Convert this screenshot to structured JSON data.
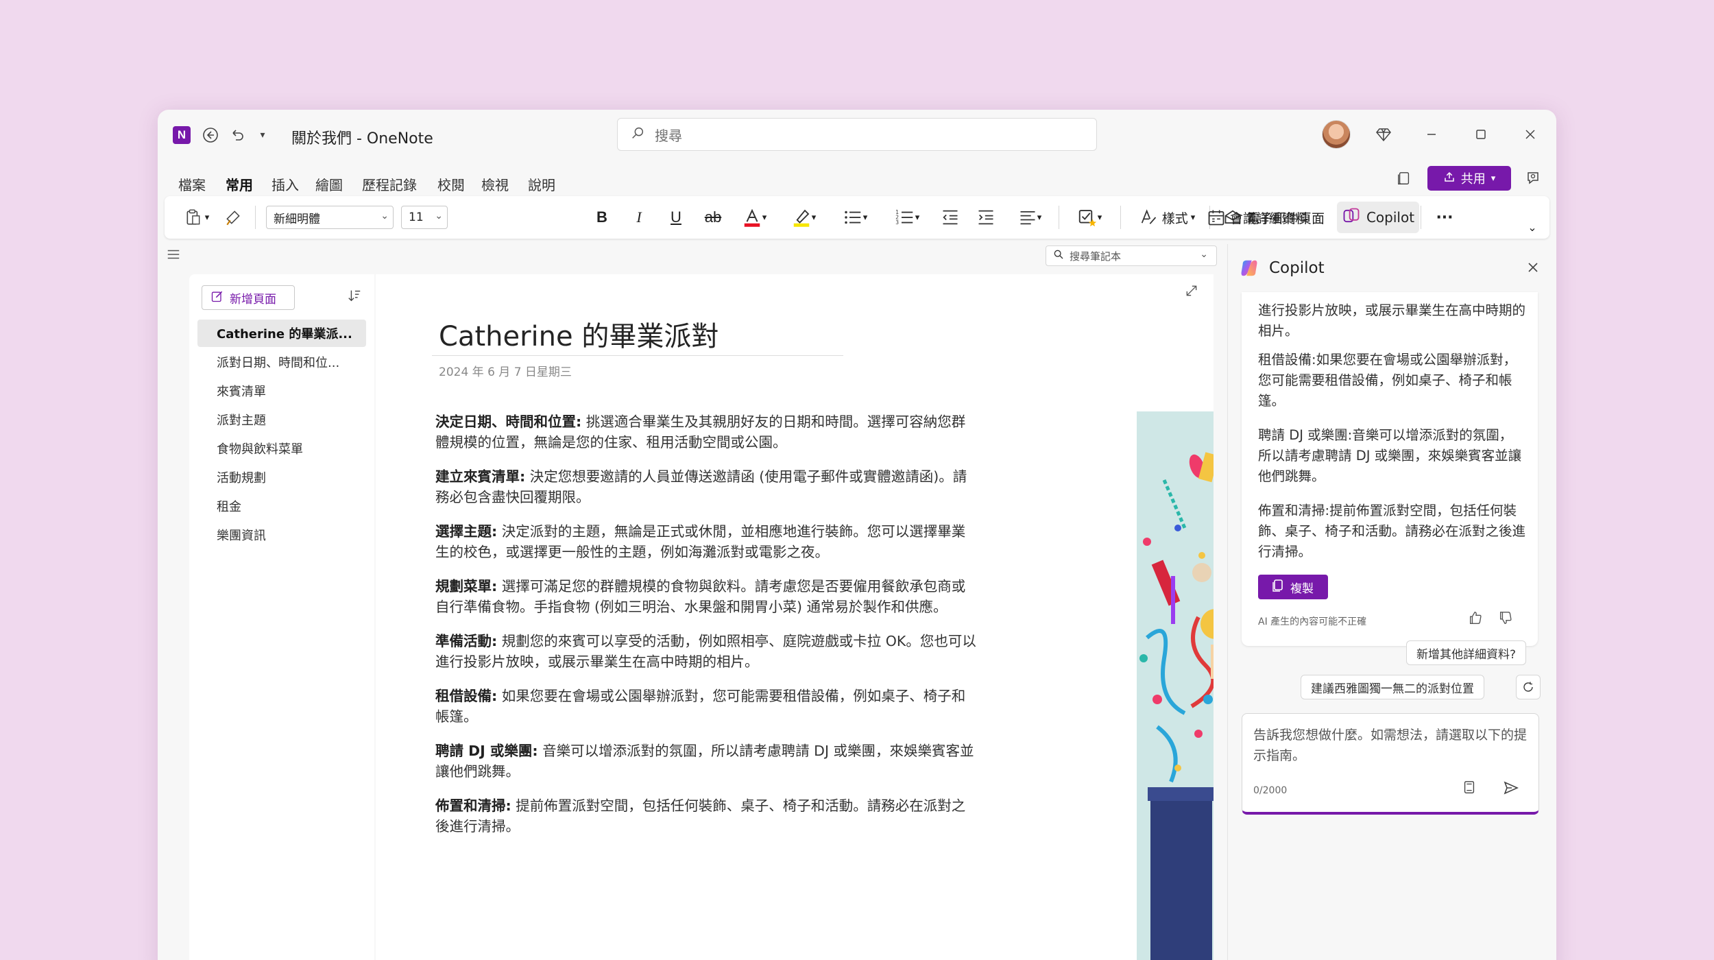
{
  "app": {
    "title": "關於我們 - OneNote",
    "logo_letter": "N",
    "search_placeholder": "搜尋"
  },
  "menu": {
    "tabs": [
      "檔案",
      "常用",
      "插入",
      "繪圖",
      "歷程記錄",
      "校閱",
      "檢視",
      "說明"
    ],
    "active": "常用",
    "share_label": "共用"
  },
  "ribbon": {
    "font_name": "新細明體",
    "font_size": "11",
    "styles_label": "樣式",
    "email_page_label": "電子郵件頁面",
    "meeting_details_label": "會議詳細資料",
    "copilot_label": "Copilot",
    "more": "···"
  },
  "notebook_search": {
    "placeholder": "搜尋筆記本"
  },
  "pages": {
    "new_page_label": "新增頁面",
    "items": [
      "Catherine 的畢業派...",
      "派對日期、時間和位...",
      "來賓清單",
      "派對主題",
      "食物與飲料菜單",
      "活動規劃",
      "租金",
      "樂團資訊"
    ]
  },
  "page": {
    "title": "Catherine 的畢業派對",
    "date": "2024 年 6 月 7 日星期三",
    "paragraphs": [
      {
        "bold": "決定日期、時間和位置:",
        "text": " 挑選適合畢業生及其親朋好友的日期和時間。選擇可容納您群體規模的位置，無論是您的住家、租用活動空間或公園。"
      },
      {
        "bold": "建立來賓清單:",
        "text": " 決定您想要邀請的人員並傳送邀請函 (使用電子郵件或實體邀請函)。請務必包含盡快回覆期限。"
      },
      {
        "bold": "選擇主題:",
        "text": " 決定派對的主題，無論是正式或休閒，並相應地進行裝飾。您可以選擇畢業生的校色，或選擇更一般性的主題，例如海灘派對或電影之夜。"
      },
      {
        "bold": "規劃菜單:",
        "text": " 選擇可滿足您的群體規模的食物與飲料。請考慮您是否要僱用餐飲承包商或自行準備食物。手指食物 (例如三明治、水果盤和開胃小菜) 通常易於製作和供應。"
      },
      {
        "bold": "準備活動:",
        "text": " 規劃您的來賓可以享受的活動，例如照相亭、庭院遊戲或卡拉 OK。您也可以進行投影片放映，或展示畢業生在高中時期的相片。"
      },
      {
        "bold": "租借設備:",
        "text": " 如果您要在會場或公園舉辦派對，您可能需要租借設備，例如桌子、椅子和帳篷。"
      },
      {
        "bold": "聘請 DJ 或樂團:",
        "text": " 音樂可以增添派對的氛圍，所以請考慮聘請 DJ 或樂團，來娛樂賓客並讓他們跳舞。"
      },
      {
        "bold": "佈置和清掃:",
        "text": " 提前佈置派對空間，包括任何裝飾、桌子、椅子和活動。請務必在派對之後進行清掃。"
      }
    ]
  },
  "copilot": {
    "title": "Copilot",
    "response": [
      "進行投影片放映，或展示畢業生在高中時期的相片。",
      "租借設備:如果您要在會場或公園舉辦派對，您可能需要租借設備，例如桌子、椅子和帳篷。",
      "聘請 DJ 或樂團:音樂可以增添派對的氛圍，所以請考慮聘請 DJ 或樂團，來娛樂賓客並讓他們跳舞。",
      "佈置和清掃:提前佈置派對空間，包括任何裝飾、桌子、椅子和活動。請務必在派對之後進行清掃。"
    ],
    "copy_label": "複製",
    "ai_disclaimer": "AI 產生的內容可能不正確",
    "suggestions": [
      "新增其他詳細資料?",
      "建議西雅圖獨一無二的派對位置"
    ],
    "input_placeholder": "告訴我您想做什麼。如需想法，請選取以下的提示指南。",
    "counter": "0/2000"
  },
  "colors": {
    "accent": "#7719aa",
    "background": "#f0d9ee"
  }
}
